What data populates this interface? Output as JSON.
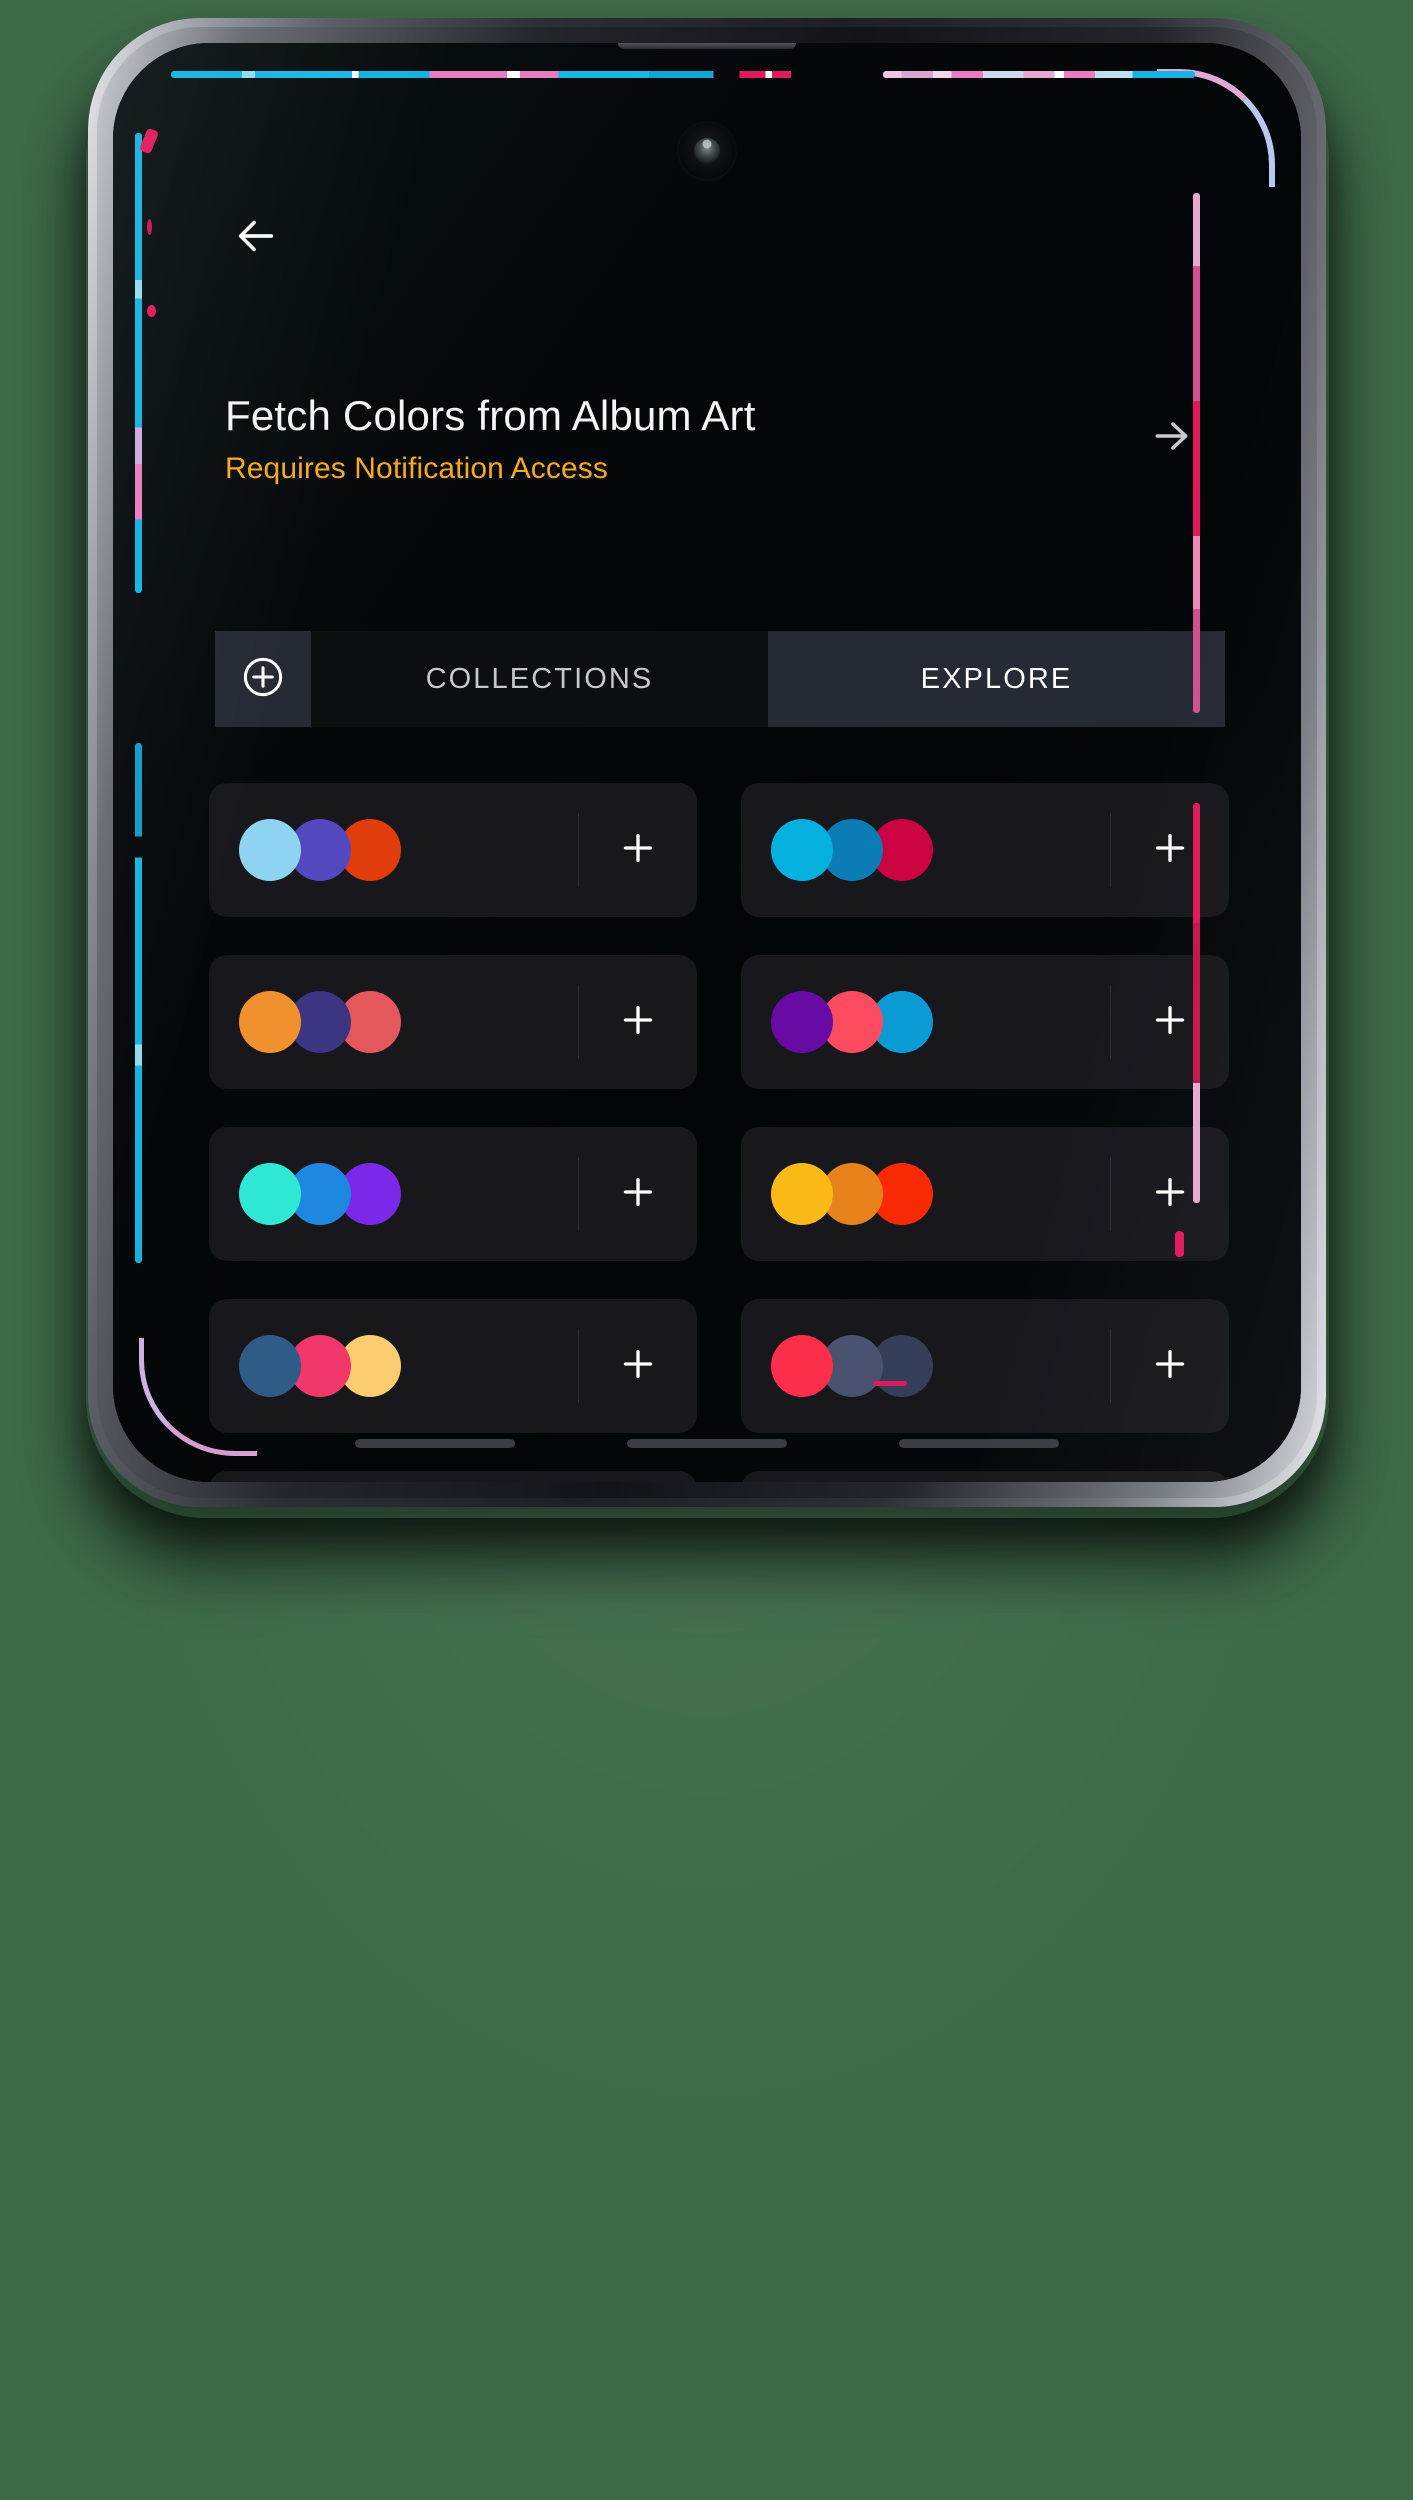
{
  "app": {
    "back_icon": "arrow-left-icon",
    "header": {
      "title": "Fetch Colors from Album Art",
      "subtitle": "Requires Notification Access",
      "subtitle_color": "#f7a81b",
      "forward_icon": "arrow-right-icon"
    },
    "tabs": {
      "add_button_icon": "plus-circle-icon",
      "items": [
        {
          "label": "COLLECTIONS",
          "active": false
        },
        {
          "label": "EXPLORE",
          "active": true
        }
      ]
    },
    "palette_add_icon": "plus-icon",
    "palettes": [
      {
        "colors": [
          "#8ed3f2",
          "#5448c0",
          "#e03c0c"
        ]
      },
      {
        "colors": [
          "#06b0de",
          "#0b7cb5",
          "#cc0343"
        ]
      },
      {
        "colors": [
          "#f0912f",
          "#3b3582",
          "#e4575b"
        ]
      },
      {
        "colors": [
          "#680ba5",
          "#fc4b5f",
          "#0a9bd5"
        ]
      },
      {
        "colors": [
          "#2ee8d5",
          "#1e88e0",
          "#7b28e8"
        ]
      },
      {
        "colors": [
          "#fcba19",
          "#e8821a",
          "#f82a06"
        ]
      },
      {
        "colors": [
          "#2e5c86",
          "#f2376b",
          "#fbcc70"
        ]
      },
      {
        "colors": [
          "#fc2e49",
          "#495370",
          "#343e58"
        ]
      },
      {
        "colors": [
          "#90994a",
          "#0a5266",
          "#63aa62"
        ]
      },
      {
        "colors": [
          "#f5d9a3",
          "#2e4408",
          "#f0e018"
        ]
      },
      {
        "colors": [
          "#0af012",
          "#5bea4a",
          "#0aea92"
        ]
      },
      {
        "colors": [
          "#f50ae8",
          "#9e16f0",
          "#5a13f5"
        ]
      },
      {
        "colors": [
          "#7a0318",
          "#a8041f",
          "#fa0a16"
        ]
      },
      {
        "colors": [
          "#0a17f5",
          "#2e3ff0",
          "#0aa3f5"
        ]
      },
      {
        "colors": [
          "#b8c2cc",
          "#2e3d4f",
          "#5e82a8"
        ]
      },
      {
        "colors": [
          "#8c8c8c",
          "#232323",
          "#969696"
        ]
      }
    ]
  },
  "device": {
    "camera_icon": "front-camera-icon",
    "gesture_bar_segments": 3
  }
}
